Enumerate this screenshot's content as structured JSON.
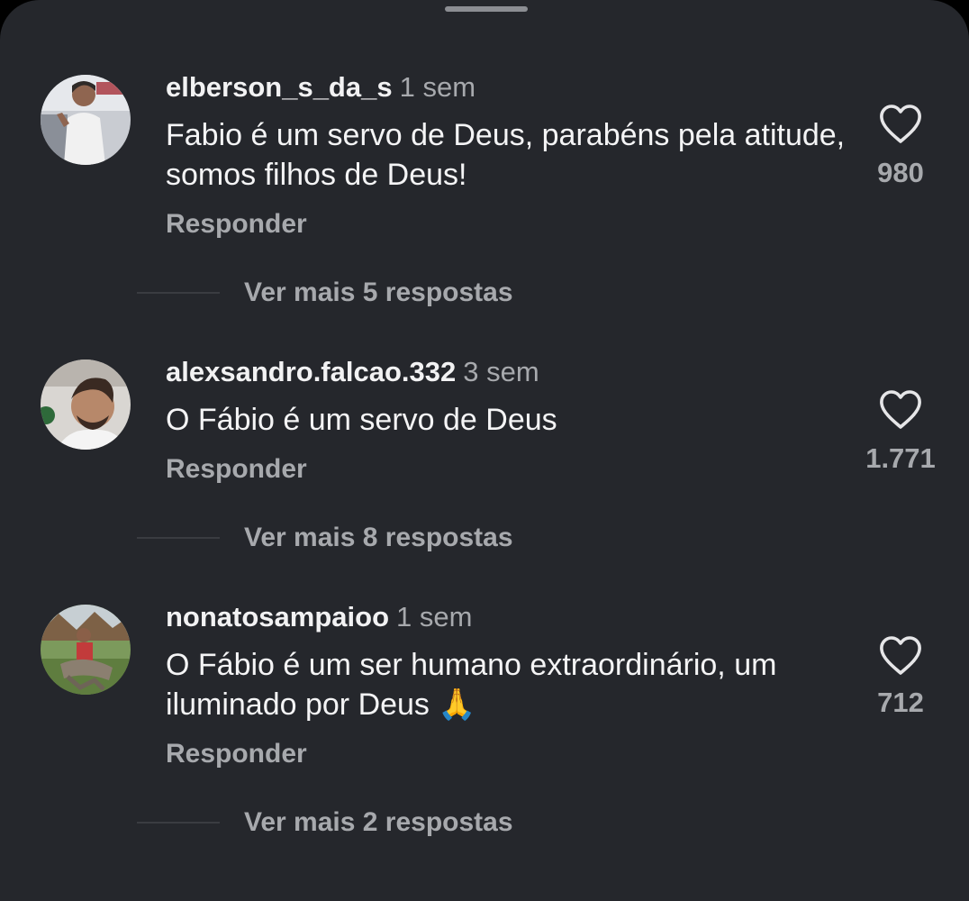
{
  "comments": [
    {
      "username": "elberson_s_da_s",
      "time": "1 sem",
      "text": "Fabio é um servo de Deus, parabéns pela atitude, somos filhos de Deus!",
      "reply_label": "Responder",
      "likes": "980",
      "more_replies": "Ver mais 5 respostas",
      "avatar_icon": "avatar-photo-icon"
    },
    {
      "username": "alexsandro.falcao.332",
      "time": "3 sem",
      "text": "O Fábio é um servo de Deus",
      "reply_label": "Responder",
      "likes": "1.771",
      "more_replies": "Ver mais 8 respostas",
      "avatar_icon": "avatar-photo-icon"
    },
    {
      "username": "nonatosampaioo",
      "time": "1 sem",
      "text": "O Fábio é um ser humano extraordinário, um iluminado por Deus 🙏",
      "reply_label": "Responder",
      "likes": "712",
      "more_replies": "Ver mais 2 respostas",
      "avatar_icon": "avatar-photo-icon"
    }
  ],
  "colors": {
    "sheet_background": "#25272c",
    "secondary_text": "#a7a9ad",
    "primary_text": "#f2f2f3"
  },
  "icons": {
    "like": "heart-outline-icon",
    "grabber": "drag-handle-icon"
  }
}
